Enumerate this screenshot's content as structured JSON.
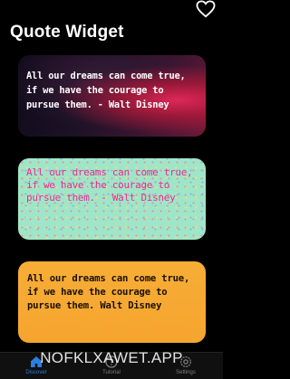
{
  "header": {
    "title": "Quote Widget",
    "favorite_icon": "heart-outline-icon"
  },
  "cards": [
    {
      "quote": "All our dreams can come true, if we have the courage to pursue them. - Walt Disney",
      "style": "dark-photo-background",
      "text_color": "#ffffff"
    },
    {
      "quote": "All our dreams can come true, if we have the courage to pursue them. - Walt Disney",
      "style": "mint-speckled-background",
      "text_color": "#ec2c92"
    },
    {
      "quote": "All our dreams can come true, if we have the courage to pursue them.   Walt Disney",
      "style": "orange-background",
      "text_color": "#1a1006"
    }
  ],
  "tabbar": {
    "tabs": [
      {
        "label": "Discover",
        "icon": "house-icon",
        "active": true
      },
      {
        "label": "Tutorial",
        "icon": "question-circle-icon",
        "active": false
      },
      {
        "label": "Settings",
        "icon": "gear-icon",
        "active": false
      }
    ],
    "accent": "#2b7fe0"
  },
  "watermark": "NOFKLXAWET.APP"
}
